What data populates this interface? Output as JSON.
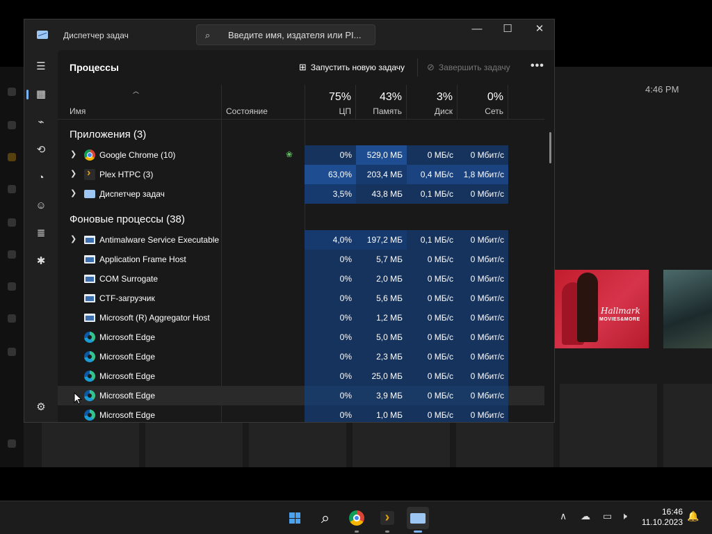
{
  "background": {
    "time": "4:46 PM",
    "poster_brand": "Hallmark",
    "poster_sub": "MOVIES&MORE"
  },
  "window": {
    "title": "Диспетчер задач",
    "search_placeholder": "Введите имя, издателя или PI...",
    "controls": {
      "minimize": "—",
      "maximize": "☐",
      "close": "✕"
    }
  },
  "sidebar": {
    "items": [
      {
        "icon": "hamburger-icon",
        "glyph": "☰"
      },
      {
        "icon": "processes-icon",
        "glyph": "▦",
        "active": true
      },
      {
        "icon": "performance-icon",
        "glyph": "⌁"
      },
      {
        "icon": "history-icon",
        "glyph": "⟲"
      },
      {
        "icon": "startup-icon",
        "glyph": "◔"
      },
      {
        "icon": "users-icon",
        "glyph": "☺"
      },
      {
        "icon": "details-icon",
        "glyph": "≣"
      },
      {
        "icon": "services-icon",
        "glyph": "✱"
      },
      {
        "icon": "settings-icon",
        "glyph": "⚙"
      }
    ]
  },
  "toolbar": {
    "page_title": "Процессы",
    "run_task": "Запустить новую задачу",
    "end_task": "Завершить задачу",
    "more": "•••"
  },
  "columns": {
    "name": "Имя",
    "status": "Состояние",
    "cpu": {
      "percent": "75%",
      "label": "ЦП"
    },
    "memory": {
      "percent": "43%",
      "label": "Память"
    },
    "disk": {
      "percent": "3%",
      "label": "Диск"
    },
    "network": {
      "percent": "0%",
      "label": "Сеть"
    }
  },
  "groups": {
    "apps": "Приложения (3)",
    "background": "Фоновые процессы (38)"
  },
  "apps": [
    {
      "name": "Google Chrome (10)",
      "icon": "chrome-icon",
      "expand": true,
      "eco": true,
      "cpu": "0%",
      "mem": "529,0 МБ",
      "disk": "0 МБ/с",
      "net": "0 Мбит/с",
      "cpu_heat": "#16335e",
      "mem_heat": "#1f4d91",
      "disk_heat": "#16335e"
    },
    {
      "name": "Plex HTPC (3)",
      "icon": "plex-icon",
      "expand": true,
      "eco": false,
      "cpu": "63,0%",
      "mem": "203,4 МБ",
      "disk": "0,4 МБ/с",
      "net": "1,8 Мбит/с",
      "cpu_heat": "#1f4d91",
      "mem_heat": "#173a6e",
      "disk_heat": "#1b4380"
    },
    {
      "name": "Диспетчер задач",
      "icon": "taskmgr-icon",
      "expand": true,
      "eco": false,
      "cpu": "3,5%",
      "mem": "43,8 МБ",
      "disk": "0,1 МБ/с",
      "net": "0 Мбит/с",
      "cpu_heat": "#173a6e",
      "mem_heat": "#16335e",
      "disk_heat": "#16335e"
    }
  ],
  "background_procs": [
    {
      "name": "Antimalware Service Executable",
      "icon": "window-icon",
      "expand": true,
      "cpu": "4,0%",
      "mem": "197,2 МБ",
      "disk": "0,1 МБ/с",
      "net": "0 Мбит/с",
      "cpu_heat": "#173a6e",
      "mem_heat": "#173a6e",
      "disk_heat": "#16335e"
    },
    {
      "name": "Application Frame Host",
      "icon": "window-icon",
      "expand": false,
      "cpu": "0%",
      "mem": "5,7 МБ",
      "disk": "0 МБ/с",
      "net": "0 Мбит/с",
      "cpu_heat": "#16335e",
      "mem_heat": "#16335e",
      "disk_heat": "#16335e"
    },
    {
      "name": "COM Surrogate",
      "icon": "window-icon",
      "expand": false,
      "cpu": "0%",
      "mem": "2,0 МБ",
      "disk": "0 МБ/с",
      "net": "0 Мбит/с",
      "cpu_heat": "#16335e",
      "mem_heat": "#16335e",
      "disk_heat": "#16335e"
    },
    {
      "name": "CTF-загрузчик",
      "icon": "window-icon",
      "expand": false,
      "cpu": "0%",
      "mem": "5,6 МБ",
      "disk": "0 МБ/с",
      "net": "0 Мбит/с",
      "cpu_heat": "#16335e",
      "mem_heat": "#16335e",
      "disk_heat": "#16335e"
    },
    {
      "name": "Microsoft (R) Aggregator Host",
      "icon": "window-icon",
      "expand": false,
      "cpu": "0%",
      "mem": "1,2 МБ",
      "disk": "0 МБ/с",
      "net": "0 Мбит/с",
      "cpu_heat": "#16335e",
      "mem_heat": "#16335e",
      "disk_heat": "#16335e"
    },
    {
      "name": "Microsoft Edge",
      "icon": "edge-icon",
      "expand": false,
      "cpu": "0%",
      "mem": "5,0 МБ",
      "disk": "0 МБ/с",
      "net": "0 Мбит/с",
      "cpu_heat": "#16335e",
      "mem_heat": "#16335e",
      "disk_heat": "#16335e"
    },
    {
      "name": "Microsoft Edge",
      "icon": "edge-icon",
      "expand": false,
      "cpu": "0%",
      "mem": "2,3 МБ",
      "disk": "0 МБ/с",
      "net": "0 Мбит/с",
      "cpu_heat": "#16335e",
      "mem_heat": "#16335e",
      "disk_heat": "#16335e"
    },
    {
      "name": "Microsoft Edge",
      "icon": "edge-icon",
      "expand": false,
      "cpu": "0%",
      "mem": "25,0 МБ",
      "disk": "0 МБ/с",
      "net": "0 Мбит/с",
      "cpu_heat": "#16335e",
      "mem_heat": "#16335e",
      "disk_heat": "#16335e"
    },
    {
      "name": "Microsoft Edge",
      "icon": "edge-icon",
      "expand": false,
      "hover": true,
      "cpu": "0%",
      "mem": "3,9 МБ",
      "disk": "0 МБ/с",
      "net": "0 Мбит/с",
      "cpu_heat": "#1a3a66",
      "mem_heat": "#1a3a66",
      "disk_heat": "#1a3a66"
    },
    {
      "name": "Microsoft Edge",
      "icon": "edge-icon",
      "expand": false,
      "cpu": "0%",
      "mem": "1,0 МБ",
      "disk": "0 МБ/с",
      "net": "0 Мбит/с",
      "cpu_heat": "#16335e",
      "mem_heat": "#16335e",
      "disk_heat": "#16335e"
    }
  ],
  "taskbar": {
    "apps": [
      {
        "name": "start",
        "icon": "windows-start-icon"
      },
      {
        "name": "search",
        "icon": "search-icon",
        "glyph": "⌕"
      },
      {
        "name": "chrome",
        "icon": "chrome-icon",
        "running": true
      },
      {
        "name": "plex",
        "icon": "plex-icon",
        "running": true
      },
      {
        "name": "taskmgr",
        "icon": "taskmgr-icon",
        "running": true,
        "active": true
      }
    ],
    "tray": {
      "chevron": "∧",
      "onedrive": "☁",
      "display": "▭",
      "volume": "🕨",
      "bell": "🔔"
    },
    "time": "16:46",
    "date": "11.10.2023"
  }
}
